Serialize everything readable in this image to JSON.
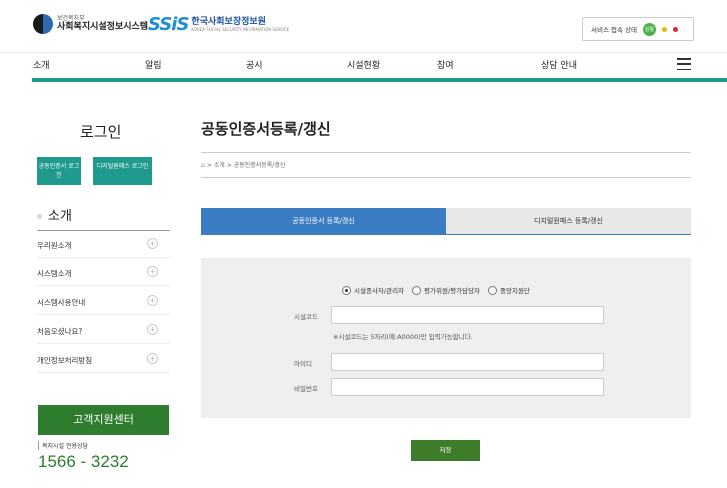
{
  "header": {
    "logo1_small": "보건복지부",
    "logo1_main": "사회복지시설정보시스템",
    "logo2_mark": "SSiS",
    "logo2_main": "한국사회보장정보원",
    "logo2_small": "KOREA SOCIAL SECURITY INFORMATION SERVICE",
    "status_label": "서비스 접속 상태",
    "status_badge": "원활",
    "colors": {
      "status_good": "#4cb04c",
      "status_warn": "#f0b400",
      "status_bad": "#e0262c"
    }
  },
  "nav": {
    "items": [
      "소개",
      "알림",
      "공시",
      "시설현황",
      "참여",
      "상담 안내"
    ]
  },
  "sidebar": {
    "login_title": "로그인",
    "login_cert": "공동인증서 로그인",
    "login_digital": "디지털원패스 로그인",
    "section_title": "소개",
    "menu": [
      "우리원소개",
      "시스템소개",
      "시스템사용안내",
      "처음오셨나요?",
      "개인정보처리방침"
    ],
    "cs_title": "고객지원센터",
    "cs_sub": "복지시설 전용상담",
    "cs_phone": "1566 - 3232"
  },
  "main": {
    "title": "공동인증서등록/갱신",
    "breadcrumb": "> 소개 > 공동인증서등록/갱신",
    "tabs": [
      "공동인증서 등록/갱신",
      "디지털원패스 등록/갱신"
    ],
    "active_tab": 0,
    "radios": [
      "시설종사자/관리자",
      "평가위원/평가담당자",
      "중앙지원단"
    ],
    "selected_radio": 0,
    "facility_code_label": "시설코드",
    "facility_code_value": "",
    "facility_code_note": "※시설코드는 5자리(예:A0000)만 입력가능합니다.",
    "id_label": "아이디",
    "id_value": "",
    "password_label": "비밀번호",
    "password_value": "",
    "save_label": "저장"
  },
  "colors": {
    "accent_teal": "#1f9a8c",
    "tab_blue": "#3b7dc4",
    "green": "#2e7d2e"
  }
}
